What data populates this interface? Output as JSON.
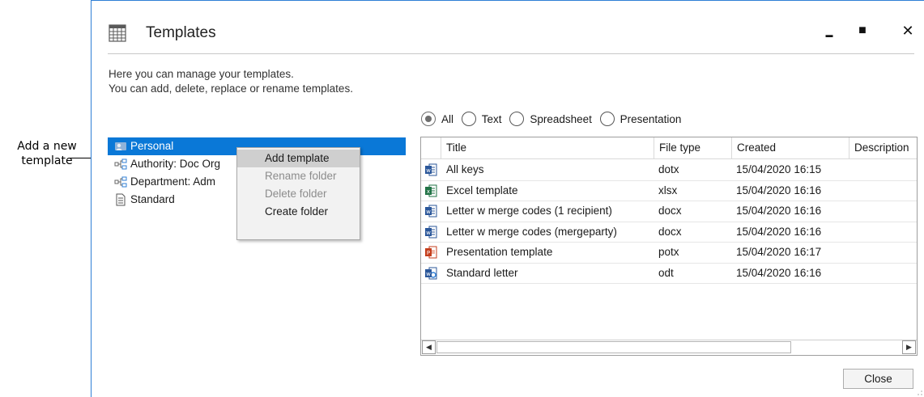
{
  "callout": {
    "line1": "Add a new",
    "line2": "template"
  },
  "window": {
    "title": "Templates",
    "min_glyph": "▬",
    "max_glyph": "■",
    "close_glyph": "✕"
  },
  "description": {
    "line1": "Here you can manage your templates.",
    "line2": "You can add, delete, replace or rename templates."
  },
  "tree": {
    "items": [
      {
        "label": "Personal",
        "icon": "personal-folder-icon"
      },
      {
        "label": "Authority: Doc Org",
        "icon": "org-tree-icon"
      },
      {
        "label": "Department: Adm",
        "icon": "org-tree-icon"
      },
      {
        "label": "Standard",
        "icon": "document-icon"
      }
    ]
  },
  "context_menu": {
    "items": [
      {
        "label": "Add template",
        "state": "hover"
      },
      {
        "label": "Rename folder",
        "state": "disabled"
      },
      {
        "label": "Delete folder",
        "state": "disabled"
      },
      {
        "label": "Create folder",
        "state": "normal"
      }
    ]
  },
  "filters": {
    "options": [
      "All",
      "Text",
      "Spreadsheet",
      "Presentation"
    ],
    "selected": "All"
  },
  "grid": {
    "columns": [
      "Title",
      "File type",
      "Created",
      "Description"
    ],
    "rows": [
      {
        "title": "All keys",
        "type": "dotx",
        "created": "15/04/2020 16:15",
        "icon": "word-template-icon"
      },
      {
        "title": "Excel template",
        "type": "xlsx",
        "created": "15/04/2020 16:16",
        "icon": "excel-icon"
      },
      {
        "title": "Letter w merge codes (1 recipient)",
        "type": "docx",
        "created": "15/04/2020 16:16",
        "icon": "word-icon"
      },
      {
        "title": "Letter w merge codes (mergeparty)",
        "type": "docx",
        "created": "15/04/2020 16:16",
        "icon": "word-icon"
      },
      {
        "title": "Presentation template",
        "type": "potx",
        "created": "15/04/2020 16:17",
        "icon": "powerpoint-icon"
      },
      {
        "title": "Standard letter",
        "type": "odt",
        "created": "15/04/2020 16:16",
        "icon": "odt-icon"
      }
    ]
  },
  "scrollbar": {
    "left_glyph": "◀",
    "right_glyph": "▶"
  },
  "footer": {
    "close_label": "Close"
  },
  "colors": {
    "selection": "#0a78d7",
    "window_border": "#2f7fd6",
    "menu_hover": "#cfcfcf"
  }
}
